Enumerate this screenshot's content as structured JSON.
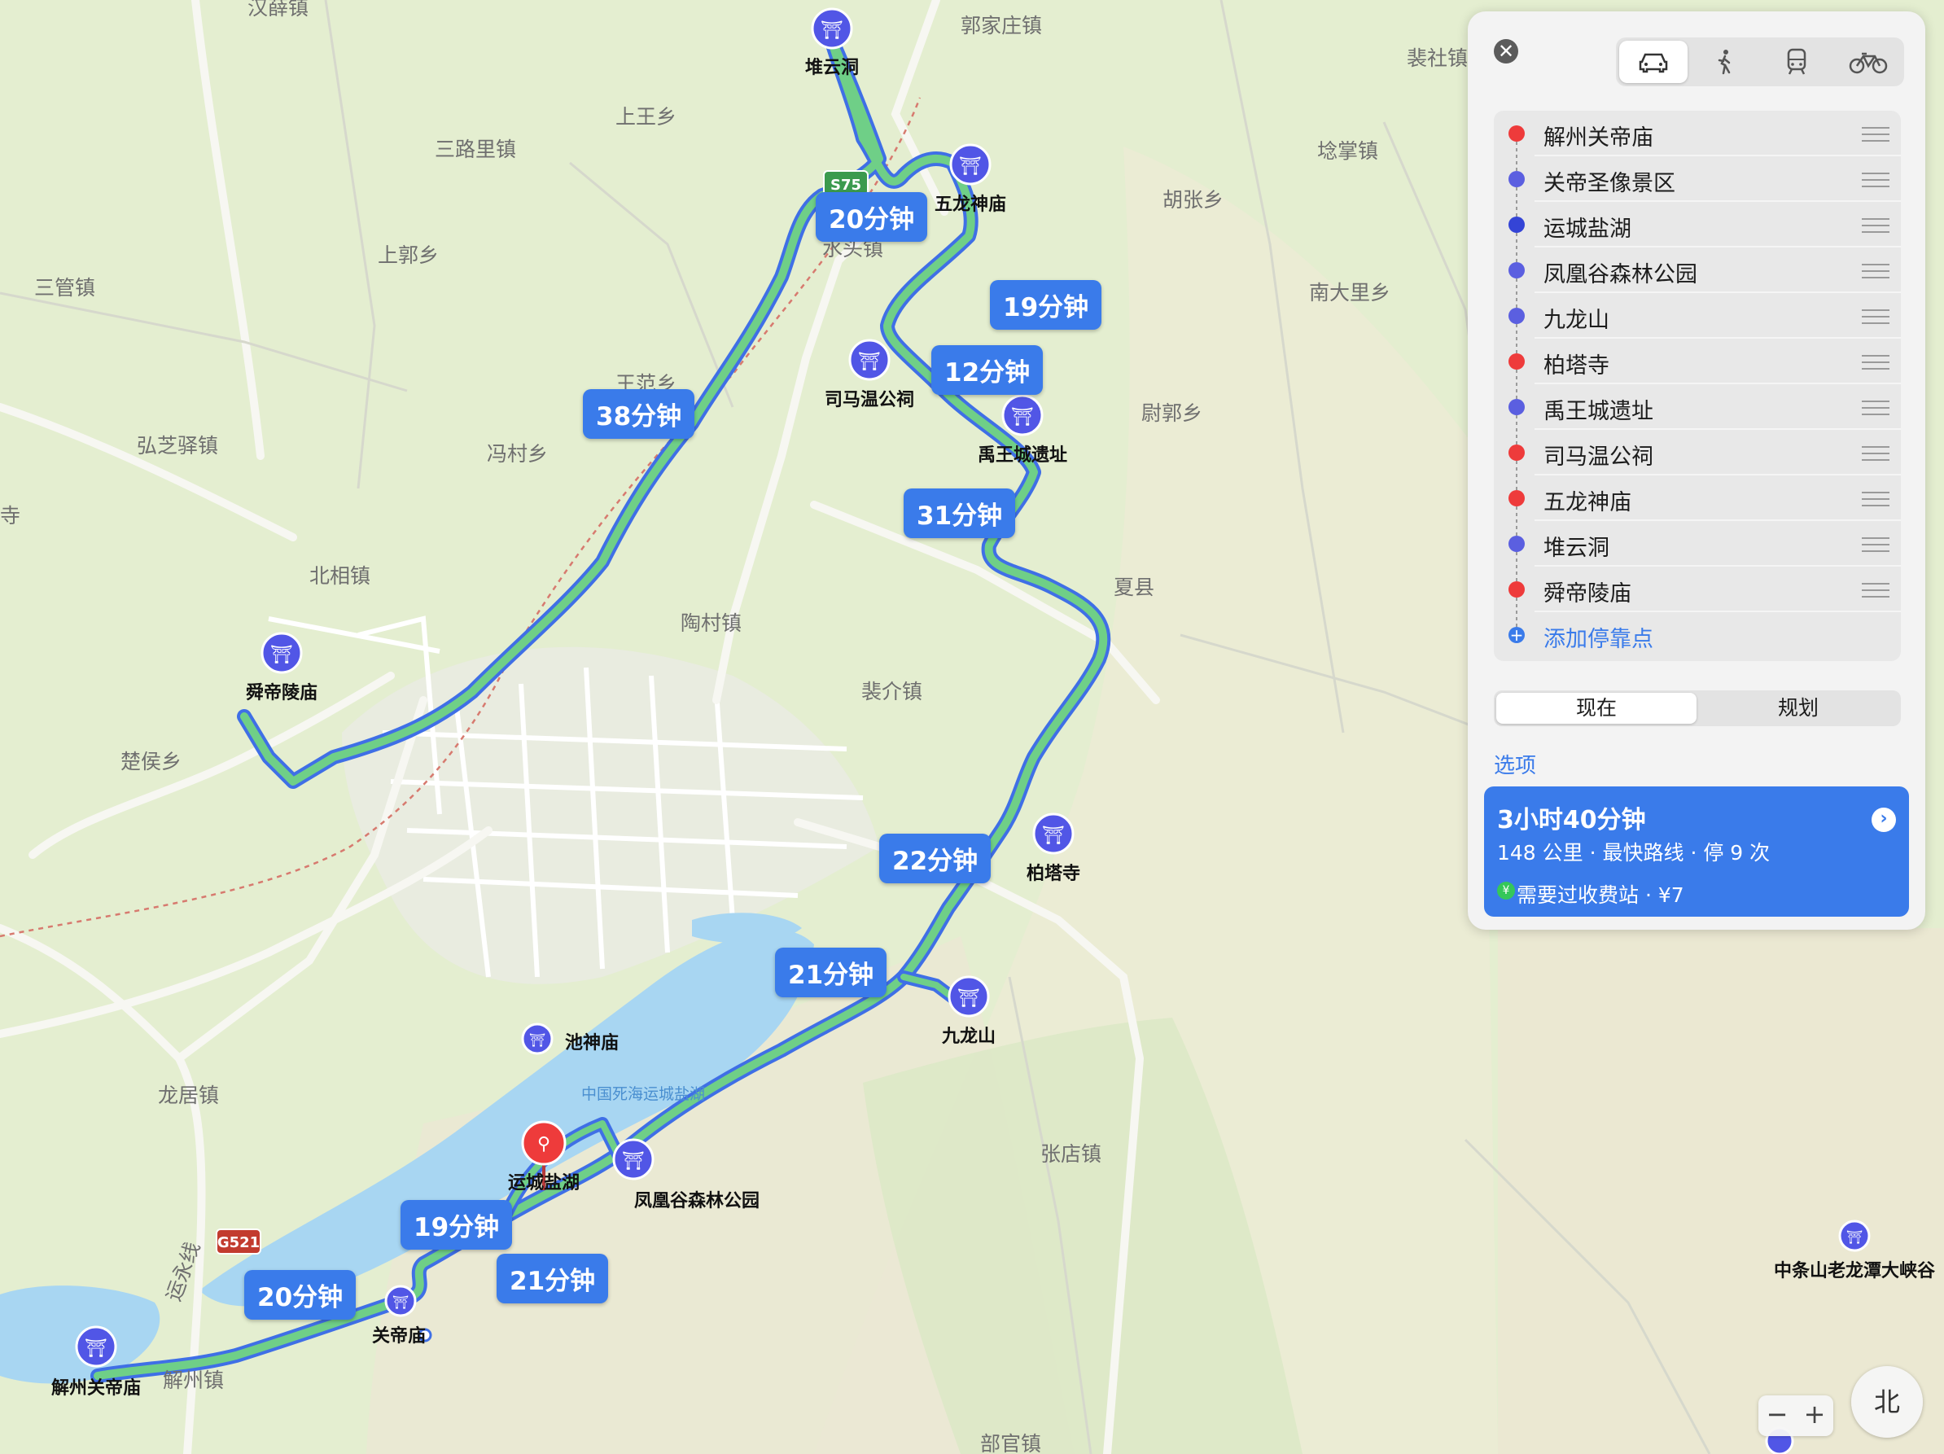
{
  "map": {
    "towns": [
      "汉薛镇",
      "郭家庄镇",
      "裴社镇",
      "上王乡",
      "三路里镇",
      "埝掌镇",
      "胡张乡",
      "三管镇",
      "上郭乡",
      "水头镇",
      "南大里乡",
      "王范乡",
      "弘芝驿镇",
      "冯村乡",
      "尉郭乡",
      "北相镇",
      "夏县",
      "陶村镇",
      "裴介镇",
      "楚侯乡",
      "龙居镇",
      "张店镇",
      "解州镇",
      "部官镇",
      "寺"
    ],
    "pois": [
      "堆云洞",
      "五龙神庙",
      "司马温公祠",
      "禹王城遗址",
      "柏塔寺",
      "舜帝陵庙",
      "九龙山",
      "池神庙",
      "运城盐湖",
      "凤凰谷森林公园",
      "关帝庙",
      "解州关帝庙",
      "中条山老龙潭大峡谷"
    ],
    "water_labels": [
      "中国死海运城盐湖"
    ],
    "road_shields": [
      "S75",
      "G521"
    ],
    "road_label": "运永线",
    "durations": [
      "20分钟",
      "19分钟",
      "12分钟",
      "38分钟",
      "31分钟",
      "22分钟",
      "21分钟",
      "19分钟",
      "21分钟",
      "20分钟"
    ],
    "zoom_out": "−",
    "zoom_in": "+",
    "compass": "北"
  },
  "panel": {
    "close": "✕",
    "modes": [
      "car-icon",
      "walk-icon",
      "transit-icon",
      "bike-icon"
    ],
    "stops": [
      {
        "name": "解州关帝庙",
        "type": "red"
      },
      {
        "name": "关帝圣像景区",
        "type": "blue"
      },
      {
        "name": "运城盐湖",
        "type": "navy"
      },
      {
        "name": "凤凰谷森林公园",
        "type": "blue"
      },
      {
        "name": "九龙山",
        "type": "blue"
      },
      {
        "name": "柏塔寺",
        "type": "red"
      },
      {
        "name": "禹王城遗址",
        "type": "blue"
      },
      {
        "name": "司马温公祠",
        "type": "red"
      },
      {
        "name": "五龙神庙",
        "type": "red"
      },
      {
        "name": "堆云洞",
        "type": "blue"
      },
      {
        "name": "舜帝陵庙",
        "type": "red"
      }
    ],
    "add_stop": "添加停靠点",
    "tabs": [
      "现在",
      "规划"
    ],
    "options": "选项",
    "route": {
      "title": "3小时40分钟",
      "summary": "148 公里 · 最快路线 · 停 9 次",
      "toll": "需要过收费站 · ¥7",
      "yen": "¥"
    }
  },
  "colors": {
    "route": "#6fcf87",
    "route_border": "#3f6fe6",
    "accent": "#3a7bea",
    "lake": "#a8d6f2",
    "land": "#e4eed0"
  }
}
